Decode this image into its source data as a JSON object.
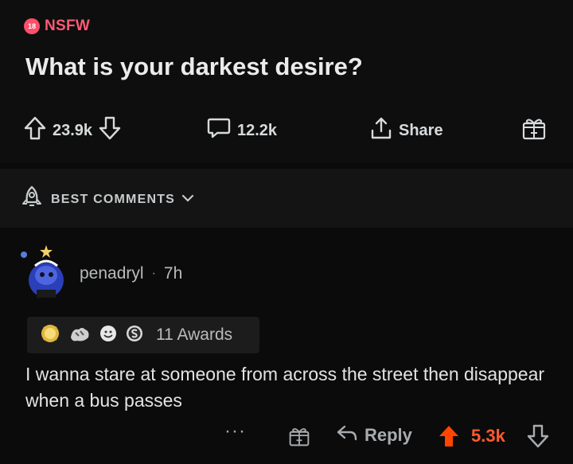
{
  "post": {
    "nsfw_badge": "18",
    "nsfw_label": "NSFW",
    "title": "What is your darkest desire?",
    "upvotes": "23.9k",
    "comments": "12.2k",
    "share_label": "Share"
  },
  "sort": {
    "label": "BEST COMMENTS"
  },
  "comment": {
    "author": "penadryl",
    "separator": "·",
    "age": "7h",
    "awards_text": "11 Awards",
    "text": "I wanna stare at someone from across the street then disappear when a bus passes",
    "more_label": "···",
    "reply_label": "Reply",
    "score": "5.3k"
  },
  "colors": {
    "nsfw": "#ff4e6a",
    "upvote_active": "#ff4500"
  }
}
